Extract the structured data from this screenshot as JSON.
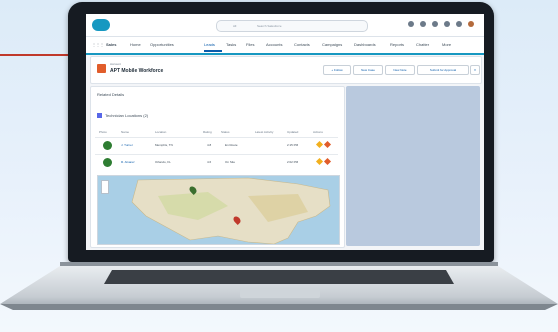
{
  "topbar": {
    "search_filter": "All",
    "search_placeholder": "Search Salesforce"
  },
  "nav": {
    "app": "Sales",
    "items": [
      "Home",
      "Opportunities",
      "Leads",
      "Tasks",
      "Files",
      "Accounts",
      "Contacts",
      "Campaigns",
      "Dashboards",
      "Reports",
      "Chatter",
      "More"
    ]
  },
  "record": {
    "type": "Account",
    "name": "APT Mobile Workforce",
    "buttons": [
      "+ Follow",
      "New Case",
      "New Note",
      "Submit for Approval"
    ]
  },
  "tabs": "Related  Details",
  "related": {
    "title": "Technician Locations (2)",
    "headers": [
      "Photo",
      "Name",
      "Location",
      "Rating",
      "Status",
      "Latest Activity",
      "Updated",
      "Actions"
    ],
    "rows": [
      {
        "name": "J. Turner",
        "location": "Memphis, TN",
        "rating": "4.8",
        "status": "En Route",
        "updated": "2:15 PM"
      },
      {
        "name": "R. Alvarez",
        "location": "Orlando, FL",
        "rating": "4.6",
        "status": "On Site",
        "updated": "2:02 PM"
      }
    ]
  },
  "colors": {
    "brand": "#1798c1",
    "accent": "#0b5cab",
    "record_icon": "#e15d2b",
    "pointer": "#c0392b"
  }
}
